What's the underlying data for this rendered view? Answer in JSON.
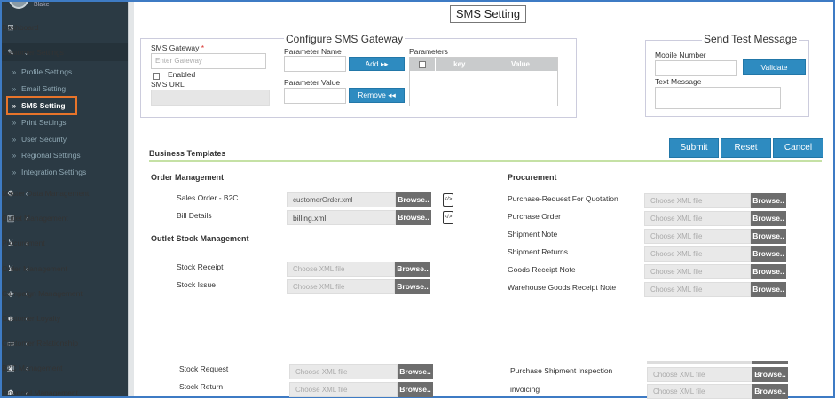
{
  "sidebar": {
    "user_name": "Blake",
    "items": [
      {
        "icon": "dashboard-icon",
        "glyph": "⊞",
        "label": "Dashboard",
        "chevron": ""
      },
      {
        "icon": "wrench-icon",
        "glyph": "✎",
        "label": "Customer Settings",
        "chevron": "⌄"
      },
      {
        "icon": "database-icon",
        "glyph": "⚙",
        "label": "Master Data Management",
        "chevron": "‹"
      },
      {
        "icon": "outlet-icon",
        "glyph": "▤",
        "label": "Outlet Management",
        "chevron": "‹"
      },
      {
        "icon": "cart-icon",
        "glyph": "⊻",
        "label": "Procurement",
        "chevron": "‹"
      },
      {
        "icon": "order-icon",
        "glyph": "⊻",
        "label": "Order Management",
        "chevron": "‹"
      },
      {
        "icon": "tag-icon",
        "glyph": "◈",
        "label": "Campaign Management",
        "chevron": "‹"
      },
      {
        "icon": "user-plus-icon",
        "glyph": "☻",
        "label": "Customer Loyalty",
        "chevron": "‹"
      },
      {
        "icon": "crm-icon",
        "glyph": "▭",
        "label": "Customer Relationship",
        "chevron": "‹"
      },
      {
        "icon": "b2c-icon",
        "glyph": "▣",
        "label": "B2C Management",
        "chevron": "‹"
      },
      {
        "icon": "finance-icon",
        "glyph": "☗",
        "label": "Financial Management",
        "chevron": "‹"
      }
    ],
    "sub_items": [
      {
        "label": "Profile Settings"
      },
      {
        "label": "Email Setting"
      },
      {
        "label": "SMS Setting"
      },
      {
        "label": "Print Settings"
      },
      {
        "label": "User Security"
      },
      {
        "label": "Regional Settings"
      },
      {
        "label": "Integration Settings"
      }
    ]
  },
  "page": {
    "title": "SMS Setting"
  },
  "gateway": {
    "heading": "Configure SMS Gateway",
    "gateway_label": "SMS Gateway",
    "required_mark": "*",
    "gateway_placeholder": "Enter Gateway",
    "enabled_label": "Enabled",
    "url_label": "SMS URL",
    "param_name_label": "Parameter Name",
    "param_value_label": "Parameter Value",
    "add_label": "Add ▸▸",
    "remove_label": "Remove ◂◂",
    "parameters_label": "Parameters",
    "col_key": "key",
    "col_value": "Value"
  },
  "test": {
    "heading": "Send Test Message",
    "mobile_label": "Mobile Number",
    "validate_label": "Validate",
    "text_label": "Text Message"
  },
  "actions": {
    "submit": "Submit",
    "reset": "Reset",
    "cancel": "Cancel"
  },
  "templates": {
    "heading": "Business Templates",
    "browse_label": "Browse..",
    "order_heading": "Order Management",
    "outlet_heading": "Outlet Stock Management",
    "procurement_heading": "Procurement",
    "order_rows": [
      {
        "label": "Sales Order - B2C",
        "file": "customerOrder.xml"
      },
      {
        "label": "Bill Details",
        "file": "billing.xml"
      }
    ],
    "outlet_rows": [
      {
        "label": "Stock Receipt",
        "file": "Choose XML file"
      },
      {
        "label": "Stock Issue",
        "file": "Choose XML file"
      }
    ],
    "procurement_rows": [
      {
        "label": "Purchase-Request For Quotation",
        "file": "Choose XML file"
      },
      {
        "label": "Purchase Order",
        "file": "Choose XML file"
      },
      {
        "label": "Shipment Note",
        "file": "Choose XML file"
      },
      {
        "label": "Shipment Returns",
        "file": "Choose XML file"
      },
      {
        "label": "Goods Receipt Note",
        "file": "Choose XML file"
      },
      {
        "label": "Warehouse Goods Receipt Note",
        "file": "Choose XML file"
      }
    ],
    "lower_left_rows": [
      {
        "label": "Stock Request",
        "file": "Choose XML file"
      },
      {
        "label": "Stock Return",
        "file": "Choose XML file"
      }
    ],
    "lower_right_rows": [
      {
        "label": "Purchase Shipment Inspection",
        "file": "Choose XML file"
      },
      {
        "label": "invoicing",
        "file": "Choose XML file"
      }
    ]
  }
}
